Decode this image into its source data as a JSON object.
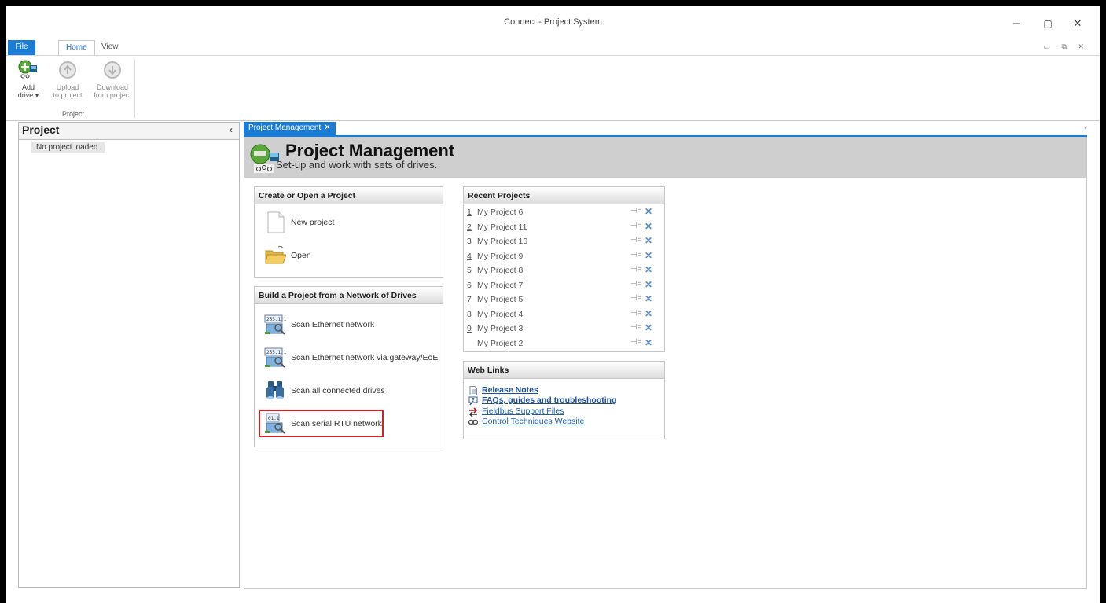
{
  "window": {
    "title": "Connect - Project System",
    "controls": {
      "minimize": "–",
      "restore": "▢",
      "close": "✕"
    },
    "mdi_controls": "▭ ⧉ ✕"
  },
  "ribbon": {
    "tabs": [
      {
        "label": "File"
      },
      {
        "label": "Home"
      },
      {
        "label": "View"
      }
    ],
    "group_label": "Project",
    "buttons": [
      {
        "line1": "Add",
        "line2": "drive ▾",
        "icon": "add-drive-icon"
      },
      {
        "line1": "Upload",
        "line2": "to project",
        "icon": "upload-icon"
      },
      {
        "line1": "Download",
        "line2": "from project",
        "icon": "download-icon"
      }
    ]
  },
  "project_panel": {
    "title": "Project",
    "collapse": "‹",
    "empty_text": "No project loaded."
  },
  "doc_tab": {
    "label": "Project Management",
    "close": "✕",
    "overflow": "▾"
  },
  "pm": {
    "title": "Project Management",
    "subtitle": "Set-up and work with sets of drives."
  },
  "create_box": {
    "header": "Create or Open a Project",
    "items": [
      {
        "label": "New project",
        "icon": "new-document-icon"
      },
      {
        "label": "Open",
        "icon": "open-folder-icon"
      }
    ]
  },
  "build_box": {
    "header": "Build a Project from a Network of Drives",
    "items": [
      {
        "label": "Scan Ethernet network",
        "icon": "ethernet-scan-icon"
      },
      {
        "label": "Scan Ethernet network via gateway/EoE",
        "icon": "ethernet-gateway-scan-icon"
      },
      {
        "label": "Scan all connected drives",
        "icon": "binoculars-icon"
      },
      {
        "label": "Scan serial RTU network",
        "icon": "serial-rtu-scan-icon"
      }
    ]
  },
  "recent_box": {
    "header": "Recent Projects",
    "pin": "⊣=",
    "remove": "✕",
    "items": [
      {
        "num": "1",
        "name": "My Project 6"
      },
      {
        "num": "2",
        "name": "My Project 11"
      },
      {
        "num": "3",
        "name": "My Project 10"
      },
      {
        "num": "4",
        "name": "My Project 9"
      },
      {
        "num": "5",
        "name": "My Project 8"
      },
      {
        "num": "6",
        "name": "My Project 7"
      },
      {
        "num": "7",
        "name": "My Project 5"
      },
      {
        "num": "8",
        "name": "My Project 4"
      },
      {
        "num": "9",
        "name": "My Project 3"
      },
      {
        "num": "",
        "name": "My Project 2"
      }
    ]
  },
  "web_links": {
    "header": "Web Links",
    "items": [
      {
        "label": "Release Notes",
        "icon": "document-icon"
      },
      {
        "label": "FAQs, guides and troubleshooting",
        "icon": "help-icon"
      },
      {
        "label": "Fieldbus Support Files",
        "icon": "transfer-arrows-icon"
      },
      {
        "label": "Control Techniques Website",
        "icon": "link-icon"
      }
    ]
  },
  "colors": {
    "accent": "#1a7cd4",
    "highlight": "#d61f26",
    "header_gray": "#cfcfcf"
  }
}
